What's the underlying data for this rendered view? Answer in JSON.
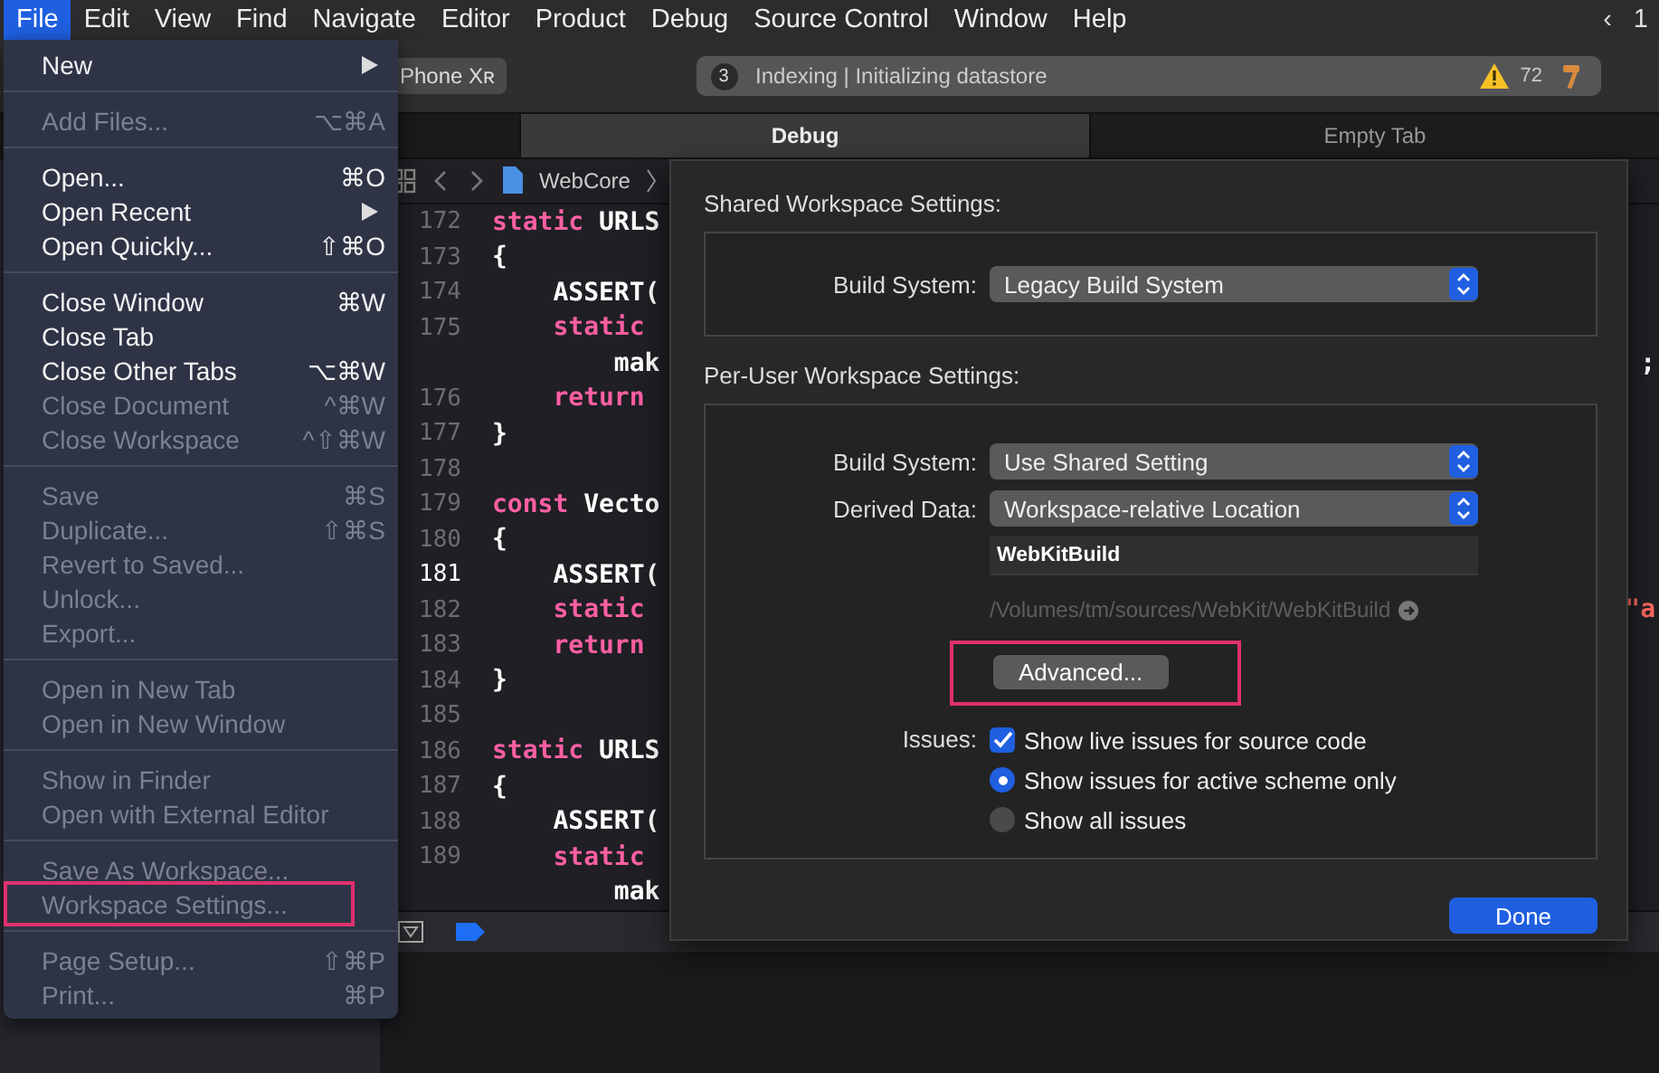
{
  "menu_bar": {
    "items": [
      {
        "label": "File",
        "selected": true
      },
      {
        "label": "Edit",
        "selected": false
      },
      {
        "label": "View",
        "selected": false
      },
      {
        "label": "Find",
        "selected": false
      },
      {
        "label": "Navigate",
        "selected": false
      },
      {
        "label": "Editor",
        "selected": false
      },
      {
        "label": "Product",
        "selected": false
      },
      {
        "label": "Debug",
        "selected": false
      },
      {
        "label": "Source Control",
        "selected": false
      },
      {
        "label": "Window",
        "selected": false
      },
      {
        "label": "Help",
        "selected": false
      }
    ],
    "status_items": [
      "‹",
      "1"
    ]
  },
  "toolbar": {
    "destination": "Phone Xʀ",
    "activity": {
      "badge": "3",
      "text": "Indexing | Initializing datastore",
      "warnings": "72"
    }
  },
  "tabs": [
    {
      "label": "Debug",
      "selected": true
    },
    {
      "label": "Empty Tab",
      "selected": false
    }
  ],
  "jump_bar": {
    "crumb": "WebCore"
  },
  "code": [
    {
      "number": "172",
      "current": false,
      "tokens": [
        {
          "text": "static",
          "kind": "keyword"
        },
        {
          "text": " URLS",
          "kind": "plain"
        }
      ]
    },
    {
      "number": "173",
      "current": false,
      "tokens": [
        {
          "text": "{",
          "kind": "plain"
        }
      ]
    },
    {
      "number": "174",
      "current": false,
      "tokens": [
        {
          "text": "    ASSERT(",
          "kind": "plain"
        }
      ]
    },
    {
      "number": "175",
      "current": false,
      "tokens": [
        {
          "text": "    static",
          "kind": "keyword"
        }
      ]
    },
    {
      "tokens": [
        {
          "text": "        mak",
          "kind": "plain"
        }
      ],
      "tail": {
        "text": ";",
        "kind": "plain"
      }
    },
    {
      "number": "176",
      "current": false,
      "tokens": [
        {
          "text": "    return",
          "kind": "keyword"
        }
      ]
    },
    {
      "number": "177",
      "current": false,
      "tokens": [
        {
          "text": "}",
          "kind": "plain"
        }
      ]
    },
    {
      "number": "178",
      "current": false
    },
    {
      "number": "179",
      "current": false,
      "tokens": [
        {
          "text": "const",
          "kind": "keyword"
        },
        {
          "text": " Vecto",
          "kind": "plain"
        }
      ]
    },
    {
      "number": "180",
      "current": false,
      "tokens": [
        {
          "text": "{",
          "kind": "plain"
        }
      ]
    },
    {
      "number": "181",
      "current": true,
      "tokens": [
        {
          "text": "    ASSERT(",
          "kind": "plain"
        }
      ]
    },
    {
      "number": "182",
      "current": false,
      "tokens": [
        {
          "text": "    static",
          "kind": "keyword"
        }
      ],
      "tail": {
        "text": "\"a",
        "kind": "string"
      }
    },
    {
      "number": "183",
      "current": false,
      "tokens": [
        {
          "text": "    return",
          "kind": "keyword"
        }
      ]
    },
    {
      "number": "184",
      "current": false,
      "tokens": [
        {
          "text": "}",
          "kind": "plain"
        }
      ]
    },
    {
      "number": "185",
      "current": false
    },
    {
      "number": "186",
      "current": false,
      "tokens": [
        {
          "text": "static",
          "kind": "keyword"
        },
        {
          "text": " URLS",
          "kind": "plain"
        }
      ]
    },
    {
      "number": "187",
      "current": false,
      "tokens": [
        {
          "text": "{",
          "kind": "plain"
        }
      ]
    },
    {
      "number": "188",
      "current": false,
      "tokens": [
        {
          "text": "    ASSERT(",
          "kind": "plain"
        }
      ]
    },
    {
      "number": "189",
      "current": false,
      "tokens": [
        {
          "text": "    static",
          "kind": "keyword"
        }
      ]
    },
    {
      "tokens": [
        {
          "text": "        mak",
          "kind": "plain"
        }
      ]
    }
  ],
  "file_menu": {
    "groups": [
      [
        {
          "label": "New",
          "submenu": true,
          "disabled": false
        }
      ],
      [
        {
          "label": "Add Files...",
          "shortcut": "⌥⌘A",
          "disabled": true,
          "annotated": false
        }
      ],
      [
        {
          "label": "Open...",
          "shortcut": "⌘O",
          "disabled": false,
          "annotated": false
        },
        {
          "label": "Open Recent",
          "submenu": true,
          "disabled": false
        },
        {
          "label": "Open Quickly...",
          "shortcut": "⇧⌘O",
          "disabled": false,
          "annotated": false
        }
      ],
      [
        {
          "label": "Close Window",
          "shortcut": "⌘W",
          "disabled": false,
          "annotated": false
        },
        {
          "label": "Close Tab",
          "disabled": false,
          "annotated": false
        },
        {
          "label": "Close Other Tabs",
          "shortcut": "⌥⌘W",
          "disabled": false,
          "annotated": false
        },
        {
          "label": "Close Document",
          "shortcut": "^⌘W",
          "disabled": true,
          "annotated": false
        },
        {
          "label": "Close Workspace",
          "shortcut": "^⇧⌘W",
          "disabled": true,
          "annotated": false
        }
      ],
      [
        {
          "label": "Save",
          "shortcut": "⌘S",
          "disabled": true,
          "annotated": false
        },
        {
          "label": "Duplicate...",
          "shortcut": "⇧⌘S",
          "disabled": true,
          "annotated": false
        },
        {
          "label": "Revert to Saved...",
          "disabled": true,
          "annotated": false
        },
        {
          "label": "Unlock...",
          "disabled": true,
          "annotated": false
        },
        {
          "label": "Export...",
          "disabled": true,
          "annotated": false
        }
      ],
      [
        {
          "label": "Open in New Tab",
          "disabled": true,
          "annotated": false
        },
        {
          "label": "Open in New Window",
          "disabled": true,
          "annotated": false
        }
      ],
      [
        {
          "label": "Show in Finder",
          "disabled": true,
          "annotated": false
        },
        {
          "label": "Open with External Editor",
          "disabled": true,
          "annotated": false
        }
      ],
      [
        {
          "label": "Save As Workspace...",
          "disabled": true,
          "annotated": false
        },
        {
          "label": "Workspace Settings...",
          "disabled": true,
          "annotated": true
        }
      ],
      [
        {
          "label": "Page Setup...",
          "shortcut": "⇧⌘P",
          "disabled": true,
          "annotated": false
        },
        {
          "label": "Print...",
          "shortcut": "⌘P",
          "disabled": true,
          "annotated": false
        }
      ]
    ]
  },
  "sheet": {
    "shared": {
      "title": "Shared Workspace Settings:",
      "build_system": {
        "label": "Build System:",
        "value": "Legacy Build System"
      }
    },
    "per_user": {
      "title": "Per-User Workspace Settings:",
      "build_system": {
        "label": "Build System:",
        "value": "Use Shared Setting"
      },
      "derived_data": {
        "label": "Derived Data:",
        "value": "Workspace-relative Location"
      },
      "folder": {
        "value": "WebKitBuild"
      },
      "path": "/Volumes/tm/sources/WebKit/WebKitBuild",
      "advanced": {
        "label": "Advanced...",
        "annotated": true
      },
      "issues": {
        "label": "Issues:",
        "live": {
          "label": "Show live issues for source code",
          "checked": true
        },
        "scope": [
          {
            "label": "Show issues for active scheme only",
            "selected": true
          },
          {
            "label": "Show all issues",
            "selected": false
          }
        ]
      }
    },
    "done": "Done"
  }
}
